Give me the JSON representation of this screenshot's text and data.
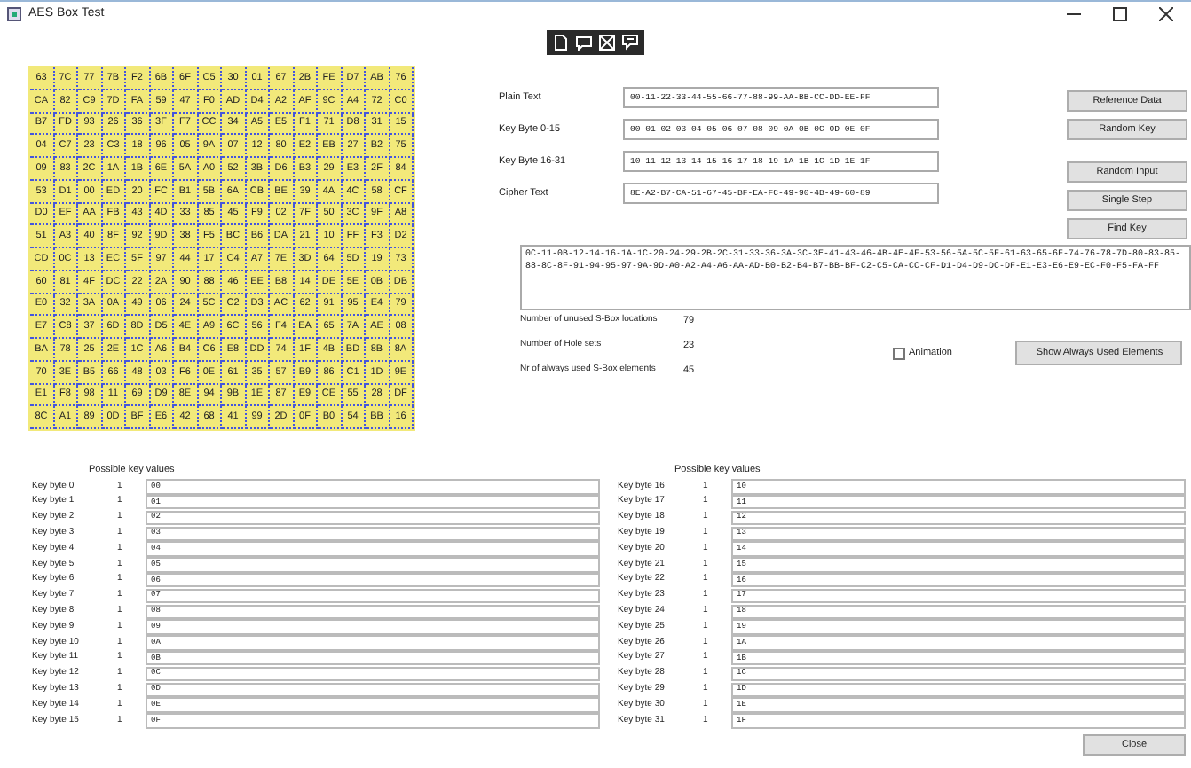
{
  "window": {
    "title": "AES Box Test"
  },
  "sbox": [
    [
      "63",
      "7C",
      "77",
      "7B",
      "F2",
      "6B",
      "6F",
      "C5",
      "30",
      "01",
      "67",
      "2B",
      "FE",
      "D7",
      "AB",
      "76"
    ],
    [
      "CA",
      "82",
      "C9",
      "7D",
      "FA",
      "59",
      "47",
      "F0",
      "AD",
      "D4",
      "A2",
      "AF",
      "9C",
      "A4",
      "72",
      "C0"
    ],
    [
      "B7",
      "FD",
      "93",
      "26",
      "36",
      "3F",
      "F7",
      "CC",
      "34",
      "A5",
      "E5",
      "F1",
      "71",
      "D8",
      "31",
      "15"
    ],
    [
      "04",
      "C7",
      "23",
      "C3",
      "18",
      "96",
      "05",
      "9A",
      "07",
      "12",
      "80",
      "E2",
      "EB",
      "27",
      "B2",
      "75"
    ],
    [
      "09",
      "83",
      "2C",
      "1A",
      "1B",
      "6E",
      "5A",
      "A0",
      "52",
      "3B",
      "D6",
      "B3",
      "29",
      "E3",
      "2F",
      "84"
    ],
    [
      "53",
      "D1",
      "00",
      "ED",
      "20",
      "FC",
      "B1",
      "5B",
      "6A",
      "CB",
      "BE",
      "39",
      "4A",
      "4C",
      "58",
      "CF"
    ],
    [
      "D0",
      "EF",
      "AA",
      "FB",
      "43",
      "4D",
      "33",
      "85",
      "45",
      "F9",
      "02",
      "7F",
      "50",
      "3C",
      "9F",
      "A8"
    ],
    [
      "51",
      "A3",
      "40",
      "8F",
      "92",
      "9D",
      "38",
      "F5",
      "BC",
      "B6",
      "DA",
      "21",
      "10",
      "FF",
      "F3",
      "D2"
    ],
    [
      "CD",
      "0C",
      "13",
      "EC",
      "5F",
      "97",
      "44",
      "17",
      "C4",
      "A7",
      "7E",
      "3D",
      "64",
      "5D",
      "19",
      "73"
    ],
    [
      "60",
      "81",
      "4F",
      "DC",
      "22",
      "2A",
      "90",
      "88",
      "46",
      "EE",
      "B8",
      "14",
      "DE",
      "5E",
      "0B",
      "DB"
    ],
    [
      "E0",
      "32",
      "3A",
      "0A",
      "49",
      "06",
      "24",
      "5C",
      "C2",
      "D3",
      "AC",
      "62",
      "91",
      "95",
      "E4",
      "79"
    ],
    [
      "E7",
      "C8",
      "37",
      "6D",
      "8D",
      "D5",
      "4E",
      "A9",
      "6C",
      "56",
      "F4",
      "EA",
      "65",
      "7A",
      "AE",
      "08"
    ],
    [
      "BA",
      "78",
      "25",
      "2E",
      "1C",
      "A6",
      "B4",
      "C6",
      "E8",
      "DD",
      "74",
      "1F",
      "4B",
      "BD",
      "8B",
      "8A"
    ],
    [
      "70",
      "3E",
      "B5",
      "66",
      "48",
      "03",
      "F6",
      "0E",
      "61",
      "35",
      "57",
      "B9",
      "86",
      "C1",
      "1D",
      "9E"
    ],
    [
      "E1",
      "F8",
      "98",
      "11",
      "69",
      "D9",
      "8E",
      "94",
      "9B",
      "1E",
      "87",
      "E9",
      "CE",
      "55",
      "28",
      "DF"
    ],
    [
      "8C",
      "A1",
      "89",
      "0D",
      "BF",
      "E6",
      "42",
      "68",
      "41",
      "99",
      "2D",
      "0F",
      "B0",
      "54",
      "BB",
      "16"
    ]
  ],
  "fields": [
    {
      "label": "Plain Text",
      "value": "00-11-22-33-44-55-66-77-88-99-AA-BB-CC-DD-EE-FF"
    },
    {
      "label": "Key Byte 0-15",
      "value": "00 01 02 03 04 05 06 07 08 09 0A 0B 0C 0D 0E 0F"
    },
    {
      "label": "Key Byte 16-31",
      "value": "10 11 12 13 14 15 16 17 18 19 1A 1B 1C 1D 1E 1F"
    },
    {
      "label": "Cipher Text",
      "value": "8E-A2-B7-CA-51-67-45-BF-EA-FC-49-90-4B-49-60-89"
    }
  ],
  "buttons": [
    "Reference Data",
    "Random Key",
    "Random Input",
    "Single Step",
    "Find Key"
  ],
  "unused_locations": "0C-11-0B-12-14-16-1A-1C-20-24-29-2B-2C-31-33-36-3A-3C-3E-41-43-46-4B-4E-4F-53-56-5A-5C-5F-61-63-65-6F-74-76-78-7D-80-83-85-88-8C-8F-91-94-95-97-9A-9D-A0-A2-A4-A6-AA-AD-B0-B2-B4-B7-BB-BF-C2-C5-CA-CC-CF-D1-D4-D9-DC-DF-E1-E3-E6-E9-EC-F0-F5-FA-FF",
  "stats": [
    {
      "label": "Number of unused S-Box locations",
      "value": "79"
    },
    {
      "label": "Number of Hole sets",
      "value": "23"
    },
    {
      "label": "Nr of always used S-Box elements",
      "value": "45"
    }
  ],
  "animation": {
    "label": "Animation",
    "checked": false
  },
  "show_button": "Show Always Used Elements",
  "key_panels": [
    {
      "header": "Possible key values",
      "rows": [
        {
          "label": "Key byte 0",
          "count": "1",
          "value": "00"
        },
        {
          "label": "Key byte 1",
          "count": "1",
          "value": "01"
        },
        {
          "label": "Key byte 2",
          "count": "1",
          "value": "02"
        },
        {
          "label": "Key byte 3",
          "count": "1",
          "value": "03"
        },
        {
          "label": "Key byte 4",
          "count": "1",
          "value": "04"
        },
        {
          "label": "Key byte 5",
          "count": "1",
          "value": "05"
        },
        {
          "label": "Key byte 6",
          "count": "1",
          "value": "06"
        },
        {
          "label": "Key byte 7",
          "count": "1",
          "value": "07"
        },
        {
          "label": "Key byte 8",
          "count": "1",
          "value": "08"
        },
        {
          "label": "Key byte 9",
          "count": "1",
          "value": "09"
        },
        {
          "label": "Key byte 10",
          "count": "1",
          "value": "0A"
        },
        {
          "label": "Key byte 11",
          "count": "1",
          "value": "0B"
        },
        {
          "label": "Key byte 12",
          "count": "1",
          "value": "0C"
        },
        {
          "label": "Key byte 13",
          "count": "1",
          "value": "0D"
        },
        {
          "label": "Key byte 14",
          "count": "1",
          "value": "0E"
        },
        {
          "label": "Key byte 15",
          "count": "1",
          "value": "0F"
        }
      ]
    },
    {
      "header": "Possible key values",
      "rows": [
        {
          "label": "Key byte 16",
          "count": "1",
          "value": "10"
        },
        {
          "label": "Key byte 17",
          "count": "1",
          "value": "11"
        },
        {
          "label": "Key byte 18",
          "count": "1",
          "value": "12"
        },
        {
          "label": "Key byte 19",
          "count": "1",
          "value": "13"
        },
        {
          "label": "Key byte 20",
          "count": "1",
          "value": "14"
        },
        {
          "label": "Key byte 21",
          "count": "1",
          "value": "15"
        },
        {
          "label": "Key byte 22",
          "count": "1",
          "value": "16"
        },
        {
          "label": "Key byte 23",
          "count": "1",
          "value": "17"
        },
        {
          "label": "Key byte 24",
          "count": "1",
          "value": "18"
        },
        {
          "label": "Key byte 25",
          "count": "1",
          "value": "19"
        },
        {
          "label": "Key byte 26",
          "count": "1",
          "value": "1A"
        },
        {
          "label": "Key byte 27",
          "count": "1",
          "value": "1B"
        },
        {
          "label": "Key byte 28",
          "count": "1",
          "value": "1C"
        },
        {
          "label": "Key byte 29",
          "count": "1",
          "value": "1D"
        },
        {
          "label": "Key byte 30",
          "count": "1",
          "value": "1E"
        },
        {
          "label": "Key byte 31",
          "count": "1",
          "value": "1F"
        }
      ]
    }
  ],
  "close_button": "Close"
}
